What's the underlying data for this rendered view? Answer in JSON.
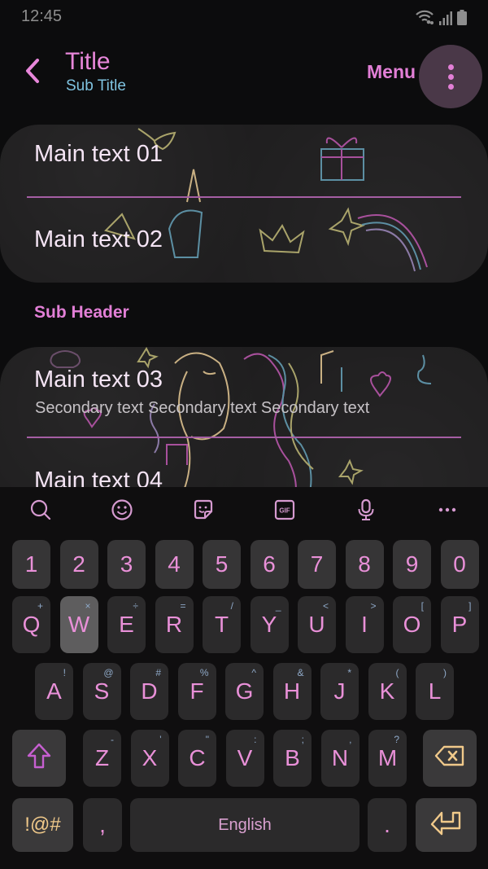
{
  "status_bar": {
    "time": "12:45",
    "icons": [
      "wifi-icon",
      "signal-icon",
      "battery-icon"
    ]
  },
  "app_bar": {
    "back_icon": "chevron-left-icon",
    "title": "Title",
    "subtitle": "Sub Title",
    "menu_label": "Menu",
    "more_icon": "more-vertical-icon"
  },
  "colors": {
    "accent_pink": "#e27fd6",
    "subtitle_blue": "#7fc3e0",
    "divider": "#a55ea4",
    "card_bg": "#1f1e1f",
    "key_bg": "#2b2a2b",
    "func_key_accent": "#f0c98a"
  },
  "list_group_1": {
    "items": [
      {
        "main": "Main text 01"
      },
      {
        "main": "Main text 02"
      }
    ]
  },
  "sub_header": "Sub Header",
  "list_group_2": {
    "items": [
      {
        "main": "Main text 03",
        "secondary": "Secondary text Secondary text Secondary text"
      },
      {
        "main": "Main text 04"
      }
    ]
  },
  "keyboard": {
    "toolbar": [
      "search-icon",
      "emoji-icon",
      "sticker-icon",
      "gif-icon",
      "microphone-icon",
      "more-horizontal-icon"
    ],
    "gif_label": "GIF",
    "number_row": [
      "1",
      "2",
      "3",
      "4",
      "5",
      "6",
      "7",
      "8",
      "9",
      "0"
    ],
    "row1": [
      {
        "key": "Q",
        "hint": "+"
      },
      {
        "key": "W",
        "hint": "×"
      },
      {
        "key": "E",
        "hint": "÷"
      },
      {
        "key": "R",
        "hint": "="
      },
      {
        "key": "T",
        "hint": "/"
      },
      {
        "key": "Y",
        "hint": "_"
      },
      {
        "key": "U",
        "hint": "<"
      },
      {
        "key": "I",
        "hint": ">"
      },
      {
        "key": "O",
        "hint": "["
      },
      {
        "key": "P",
        "hint": "]"
      }
    ],
    "row2": [
      {
        "key": "A",
        "hint": "!"
      },
      {
        "key": "S",
        "hint": "@"
      },
      {
        "key": "D",
        "hint": "#"
      },
      {
        "key": "F",
        "hint": "%"
      },
      {
        "key": "G",
        "hint": "^"
      },
      {
        "key": "H",
        "hint": "&"
      },
      {
        "key": "J",
        "hint": "*"
      },
      {
        "key": "K",
        "hint": "("
      },
      {
        "key": "L",
        "hint": ")"
      }
    ],
    "row3": [
      {
        "key": "Z",
        "hint": "-"
      },
      {
        "key": "X",
        "hint": "'"
      },
      {
        "key": "C",
        "hint": "\""
      },
      {
        "key": "V",
        "hint": ":"
      },
      {
        "key": "B",
        "hint": ";"
      },
      {
        "key": "N",
        "hint": ","
      },
      {
        "key": "M",
        "hint": "?"
      }
    ],
    "pressed_key": "W",
    "symbols_label": "!@#",
    "comma": ",",
    "space_label": "English",
    "period": ".",
    "shift_icon": "shift-arrow-icon",
    "backspace_icon": "backspace-icon",
    "enter_icon": "enter-icon"
  }
}
